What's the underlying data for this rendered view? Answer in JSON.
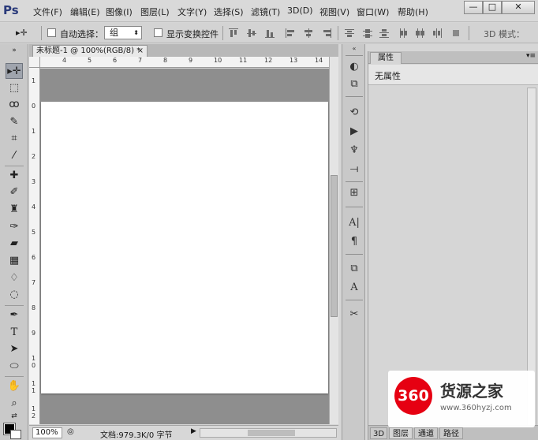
{
  "app": {
    "logo": "Ps"
  },
  "menu": [
    "文件(F)",
    "编辑(E)",
    "图像(I)",
    "图层(L)",
    "文字(Y)",
    "选择(S)",
    "滤镜(T)",
    "3D(D)",
    "视图(V)",
    "窗口(W)",
    "帮助(H)"
  ],
  "window_controls": {
    "minimize": "—",
    "maximize": "□",
    "close": "✕"
  },
  "options": {
    "move_tool_icon": "▸✛",
    "auto_select_label": "自动选择：",
    "auto_select_checked": false,
    "auto_select_value": "组",
    "show_transform_label": "显示变换控件",
    "show_transform_checked": false,
    "mode_3d_label": "3D 模式："
  },
  "document": {
    "tab_title": "未标题-1 @ 100%(RGB/8) *",
    "ruler_top": [
      "4",
      "5",
      "6",
      "7",
      "8",
      "9",
      "10",
      "11",
      "12",
      "13",
      "14"
    ],
    "ruler_left": [
      "1",
      "0",
      "1",
      "2",
      "3",
      "4",
      "5",
      "6",
      "7",
      "8",
      "9",
      "1 0",
      "1 1",
      "1 2"
    ],
    "zoom": "100%",
    "doc_info": "文档:979.3K/0 字节"
  },
  "properties": {
    "tab_label": "属性",
    "empty_text": "无属性"
  },
  "bottom_tabs": [
    "3D",
    "图层",
    "通道",
    "路径"
  ],
  "watermark": {
    "badge": "360",
    "title": "货源之家",
    "url": "www.360hyzj.com"
  },
  "colors": {
    "foreground": "#000000",
    "background": "#ffffff",
    "canvas_bg": "#8e8e8e",
    "ui_gray": "#d6d6d6",
    "watermark_red": "#e60012"
  }
}
